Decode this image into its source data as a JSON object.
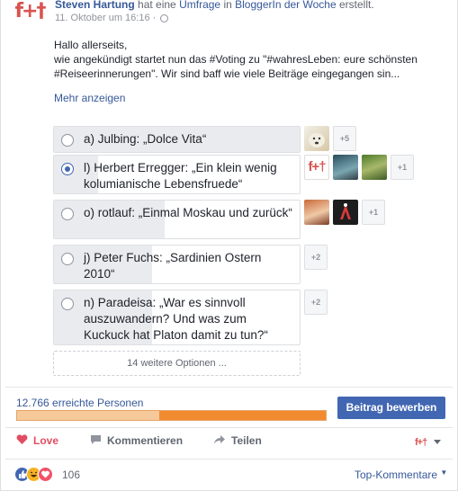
{
  "post": {
    "avatar_text": "f+†",
    "author": "Steven Hartung",
    "action_pre": "hat eine",
    "action_link": "Umfrage",
    "action_mid": "in",
    "group": "BloggerIn der Woche",
    "action_post": "erstellt.",
    "timestamp": "11. Oktober um 16:16 ·",
    "body_line1": "Hallo allerseits,",
    "body_line2": "wie angekündigt startet nun das #Voting zu \"#wahresLeben: eure schönsten #Reiseerinnerungen\". Wir sind baff wie viele Beiträge eingegangen sin...",
    "more_link": "Mehr anzeigen"
  },
  "poll": {
    "options": [
      {
        "label": "a) Julbing: „Dolce Vita“",
        "selected": false,
        "fill": 1.0,
        "extra": "+5"
      },
      {
        "label": "l) Herbert Erregger: „Ein klein wenig kolumianische Lebensfruede“",
        "selected": true,
        "fill": 0.18,
        "extra": "+1"
      },
      {
        "label": "o) rotlauf: „Einmal Moskau und zurück“",
        "selected": false,
        "fill": 0.45,
        "extra": "+1"
      },
      {
        "label": "j) Peter Fuchs: „Sardinien Ostern 2010“",
        "selected": false,
        "fill": 0.4,
        "extra": "+2"
      },
      {
        "label": "n) Paradeisa: „War es sinnvoll auszuwandern? Und was zum Kuckuck hat Platon damit zu tun?“",
        "selected": false,
        "fill": 0.4,
        "extra": "+2"
      }
    ],
    "more_options": "14 weitere Optionen ..."
  },
  "reach": {
    "label": "12.766 erreichte Personen",
    "progress": 0.54,
    "promote_button": "Beitrag bewerben"
  },
  "actions": {
    "love": "Love",
    "comment": "Kommentieren",
    "share": "Teilen",
    "page_icon": "f+†"
  },
  "footer": {
    "reaction_count": "106",
    "sort_label": "Top-Kommentare"
  },
  "colors": {
    "link": "#365899",
    "accent": "#4267b2",
    "love": "#e24c61",
    "reach_fill": "#f28b2f"
  }
}
